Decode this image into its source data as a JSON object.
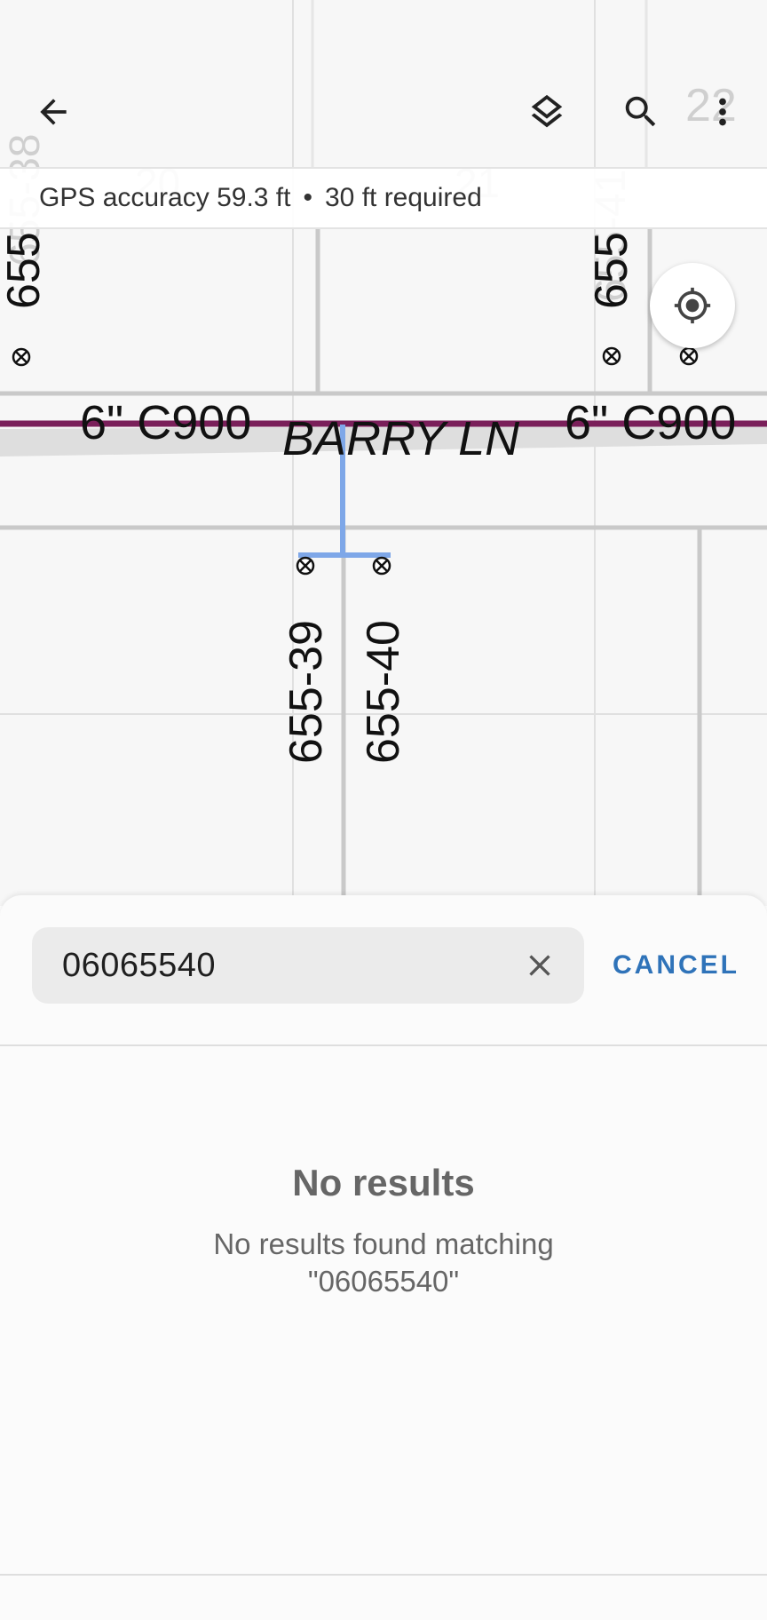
{
  "map": {
    "main_labels": {
      "pipe_left": "6\" C900",
      "pipe_right": "6\" C900",
      "street": "BARRY LN",
      "parcel_left_top": "655",
      "parcel_right_top": "655",
      "parcel_39": "655-39",
      "parcel_40": "655-40"
    },
    "faint_labels": {
      "left_top": "655-38",
      "mid_20": "20",
      "mid_21": "21",
      "right_top": "655-41",
      "corner_22": "22"
    }
  },
  "toolbar": {
    "back_icon": "arrow-left-icon",
    "layers_icon": "layers-icon",
    "search_icon": "search-icon",
    "more_icon": "more-vertical-icon"
  },
  "gps": {
    "accuracy": "GPS accuracy 59.3 ft",
    "separator": "•",
    "required": "30 ft required"
  },
  "locate_icon": "crosshair-icon",
  "search": {
    "query": "06065540",
    "clear_icon": "close-icon",
    "cancel_label": "CANCEL"
  },
  "results": {
    "title": "No results",
    "message": "No results found matching \"06065540\""
  },
  "colors": {
    "main_pipe": "#7a1f5a",
    "service_line": "#7ea7e8",
    "accent": "#2f73b9"
  }
}
